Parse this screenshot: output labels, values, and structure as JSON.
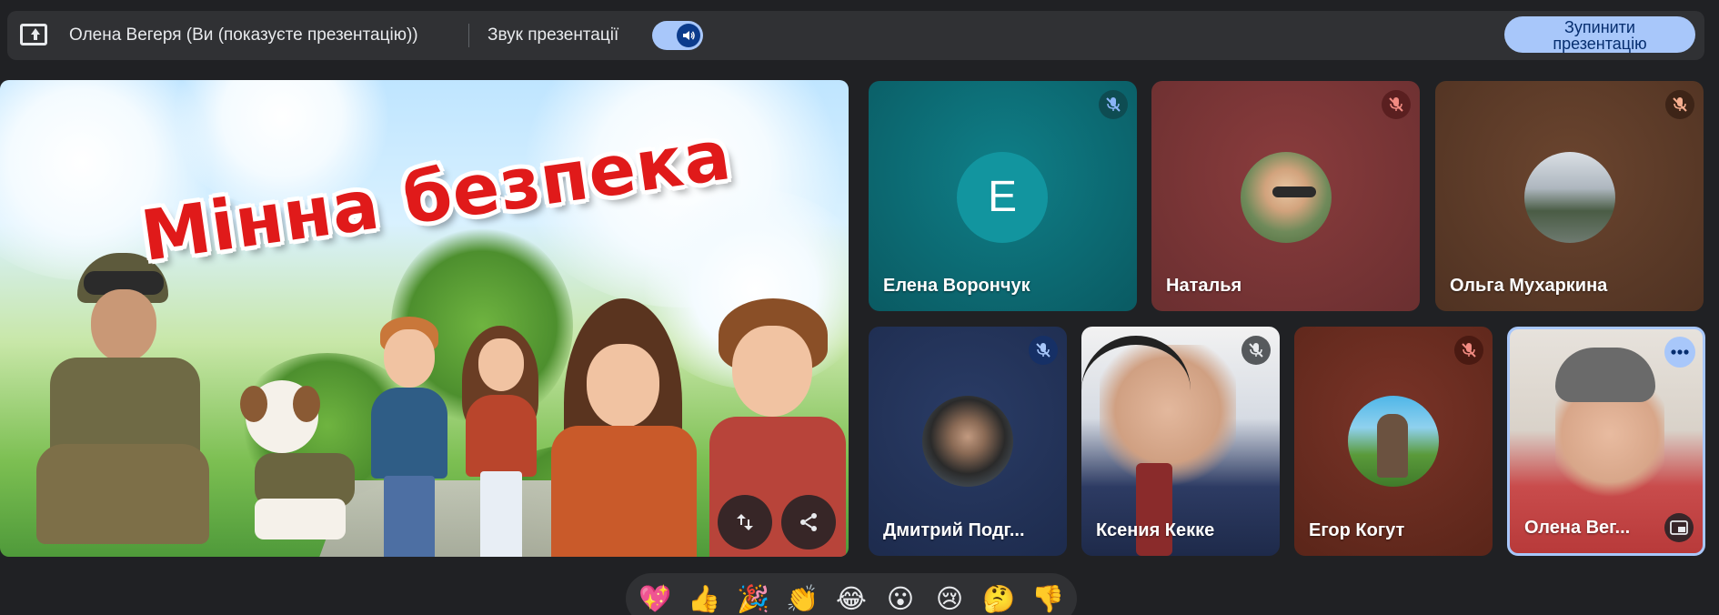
{
  "topbar": {
    "presenter_name": "Олена Вегеря (Ви (показуєте презентацію))",
    "sound_label": "Звук презентації",
    "sound_on": true,
    "stop_button_label": "Зупинити\nпрезентацію",
    "accent": "#a8c7fa"
  },
  "slide": {
    "title": "Мінна безпека",
    "actions": [
      {
        "name": "swap-layout",
        "icon": "swap-vertical-icon"
      },
      {
        "name": "share",
        "icon": "share-icon"
      }
    ]
  },
  "participants": [
    {
      "name": "Елена Ворончук",
      "muted": true,
      "avatar_letter": "E",
      "avatar_color": "#12959f",
      "tile_color": "#0c6a72"
    },
    {
      "name": "Наталья",
      "muted": true,
      "tile_color": "#7a3637"
    },
    {
      "name": "Ольга Мухаркина",
      "muted": true,
      "tile_color": "#5d3a28"
    },
    {
      "name": "Дмитрий Подг...",
      "muted": true,
      "tile_color": "#223257"
    },
    {
      "name": "Ксения Кекке",
      "muted": true,
      "video": true
    },
    {
      "name": "Егор Когут",
      "muted": true,
      "tile_color": "#6b2d22"
    },
    {
      "name": "Олена Вег...",
      "video": true,
      "self": true
    }
  ],
  "reactions": [
    "💖",
    "👍",
    "🎉",
    "👏",
    "😂",
    "😮",
    "😢",
    "🤔",
    "👎"
  ]
}
